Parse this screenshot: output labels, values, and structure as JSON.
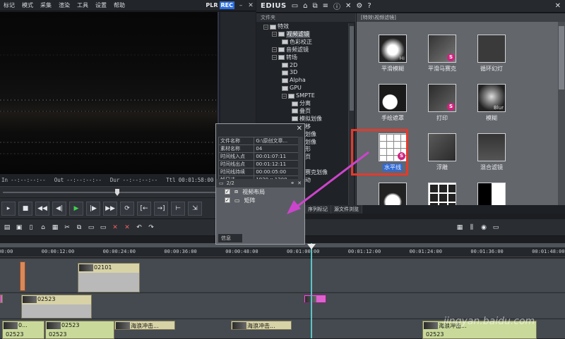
{
  "menubar": {
    "items": [
      "标记",
      "模式",
      "采集",
      "渲染",
      "工具",
      "设置",
      "帮助"
    ],
    "plr": "PLR",
    "rec": "REC"
  },
  "timecodes": {
    "in_label": "In",
    "in_value": "--:--:--:--",
    "out_label": "Out",
    "out_value": "--:--:--:--",
    "dur_label": "Dur",
    "dur_value": "--:--:--:--",
    "ttl_label": "Ttl",
    "ttl_value": "00:01:58:00"
  },
  "right_header": {
    "title": "EDIUS"
  },
  "folder_panel": {
    "title": "文件夹",
    "tree": [
      {
        "label": "特效",
        "level": 0
      },
      {
        "label": "视频滤镜",
        "level": 1,
        "selected": true
      },
      {
        "label": "色彩校正",
        "level": 2
      },
      {
        "label": "音频滤镜",
        "level": 1
      },
      {
        "label": "转场",
        "level": 1
      },
      {
        "label": "2D",
        "level": 2
      },
      {
        "label": "3D",
        "level": 2
      },
      {
        "label": "Alpha",
        "level": 2
      },
      {
        "label": "GPU",
        "level": 2
      },
      {
        "label": "SMPTE",
        "level": 2
      },
      {
        "label": "分离",
        "level": 3
      },
      {
        "label": "叠页",
        "level": 3
      },
      {
        "label": "模拟划像",
        "level": 3
      },
      {
        "label": "推移",
        "level": 3
      },
      {
        "label": "单划像",
        "level": 3
      },
      {
        "label": "条划像",
        "level": 3
      },
      {
        "label": "矩形",
        "level": 3
      },
      {
        "label": "翻页",
        "level": 3
      },
      {
        "label": "门",
        "level": 3
      },
      {
        "label": "马赛克划像",
        "level": 3
      },
      {
        "label": "滑动",
        "level": 3
      }
    ]
  },
  "effects_panel": {
    "path": "[特效\\视频滤镜]",
    "items": [
      {
        "label": "平滑模糊",
        "badge": ""
      },
      {
        "label": "平滑马赛克",
        "badge": "S"
      },
      {
        "label": "循环幻灯",
        "badge": ""
      },
      {
        "label": "手绘遮罩",
        "badge": ""
      },
      {
        "label": "打印",
        "badge": "S"
      },
      {
        "label": "模糊",
        "badge": ""
      },
      {
        "label": "水平线",
        "badge": "S"
      },
      {
        "label": "浮雕",
        "badge": ""
      },
      {
        "label": "混合滤镜",
        "badge": ""
      },
      {
        "label": "",
        "badge": ""
      },
      {
        "label": "",
        "badge": ""
      },
      {
        "label": "",
        "badge": ""
      }
    ],
    "thumb_text_blur": "Blur",
    "thumb_text_hi": "Hi"
  },
  "info_dialog": {
    "rows": [
      [
        "文件名称",
        "G:\\原创文章..."
      ],
      [
        "素材名称",
        "04"
      ],
      [
        "时间线入点",
        "00:01:07:11"
      ],
      [
        "时间线出点",
        "00:01:12:11"
      ],
      [
        "时间线持续",
        "00:00:05:00"
      ],
      [
        "帧尺寸",
        "1920 x 1200"
      ]
    ],
    "page": "2/2",
    "layers": [
      "视频布局",
      "矩阵"
    ],
    "footer_tab": "信息"
  },
  "tabs_row": [
    "序列标记",
    "源文件浏览"
  ],
  "ruler": {
    "ticks": [
      "00:00:00:00",
      "00:00:12:00",
      "00:00:24:00",
      "00:00:36:00",
      "00:00:48:00",
      "00:01:00:00",
      "00:01:12:00",
      "00:01:24:00",
      "00:01:36:00",
      "00:01:48:00"
    ]
  },
  "clips": {
    "c1": "02101",
    "c2": "02523",
    "c3": "02523",
    "c4": "0...",
    "c5": "02523",
    "c6": "海浪冲击...",
    "c7": "海浪冲击...",
    "c8": "海浪冲击...",
    "c9": "02523",
    "c10": "02523"
  },
  "watermark": "jingyan.baidu.com",
  "colors": {
    "accent_red": "#e33a2c",
    "arrow_magenta": "#cc44cc",
    "rec_blue": "#2a6de0",
    "timeline_cursor": "#58c5c8"
  }
}
